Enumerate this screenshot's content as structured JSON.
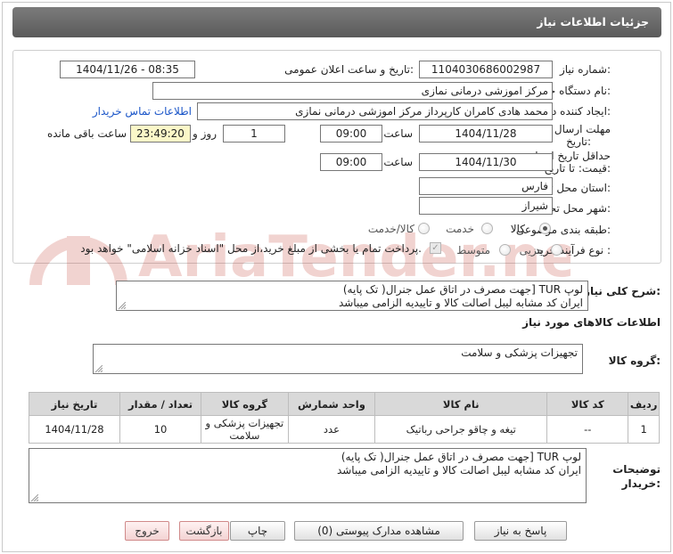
{
  "header": {
    "title": "جزئیات اطلاعات نیاز"
  },
  "form": {
    "need_number_label": "شماره نیاز:",
    "need_number": "1104030686002987",
    "announce_label": "تاریخ و ساعت اعلان عمومی:",
    "announce_value": "1404/11/26 - 08:35",
    "buyer_org_label": "نام دستگاه خریدار:",
    "buyer_org": "مرکز اموزشی درمانی نمازی",
    "creator_label": "ایجاد کننده درخواست:",
    "creator": "محمد هادی کامران کارپرداز مرکز اموزشی درمانی نمازی",
    "contact_link": "اطلاعات تماس خریدار",
    "deadline_label_1": "مهلت ارسال پاسخ: تا",
    "deadline_label_2": "تاریخ:",
    "deadline_date": "1404/11/28",
    "time_label": "ساعت",
    "deadline_time": "09:00",
    "days_value": "1",
    "days_label": "روز و",
    "remaining_time": "23:49:20",
    "remaining_label": "ساعت باقی مانده",
    "validity_label_1": "حداقل تاریخ اعتبار",
    "validity_label_2": "قیمت: تا تاریخ:",
    "validity_date": "1404/11/30",
    "validity_time": "09:00",
    "province_label": "استان محل تحویل:",
    "province": "فارس",
    "city_label": "شهر محل تحویل:",
    "city": "شیراز",
    "category_label": "طبقه بندی موضوعی:",
    "category_options": [
      "کالا",
      "خدمت",
      "کالا/خدمت"
    ],
    "process_label": "نوع فرآیند خرید :",
    "process_options": [
      "جزیی",
      "متوسط"
    ],
    "payment_note": "پرداخت تمام یا بخشی از مبلغ خرید،از محل \"اسناد خزانه اسلامی\" خواهد بود."
  },
  "general_desc": {
    "label": "شرح کلی نیاز:",
    "lines": [
      "لوپ TUR [جهت مصرف در اتاق عمل جنرال( تک پایه)",
      "ایران کد مشابه لیبل اصالت کالا و تاییدیه الزامی میباشد"
    ]
  },
  "goods_info": {
    "title": "اطلاعات کالاهای مورد نیاز",
    "group_label": "گروه کالا:",
    "group_value": "تجهیزات پزشکی و سلامت"
  },
  "table": {
    "headers": [
      "ردیف",
      "کد کالا",
      "نام کالا",
      "واحد شمارش",
      "گروه کالا",
      "تعداد / مقدار",
      "تاریخ نیاز"
    ],
    "rows": [
      [
        "1",
        "--",
        "تیغه و چاقو جراحی رباتیک",
        "عدد",
        "تجهیزات پزشکی و سلامت",
        "10",
        "1404/11/28"
      ]
    ]
  },
  "buyer_desc": {
    "label_1": "توضیحات",
    "label_2": "خریدار:",
    "lines": [
      "لوپ TUR [جهت مصرف در اتاق عمل جنرال( تک پایه)",
      "ایران کد مشابه لیبل اصالت کالا و تاییدیه الزامی میباشد"
    ]
  },
  "buttons": {
    "reply": "پاسخ به نیاز",
    "attachments": "مشاهده مدارک پیوستی (0)",
    "print": "چاپ",
    "back": "بازگشت",
    "exit": "خروج"
  },
  "colors": {
    "header_bg": "#6b6b6b",
    "link": "#1a55c8",
    "time_highlight": "#fbf7c8",
    "watermark": "#c23a2e"
  },
  "watermark": {
    "text": "AriaTender.net"
  }
}
